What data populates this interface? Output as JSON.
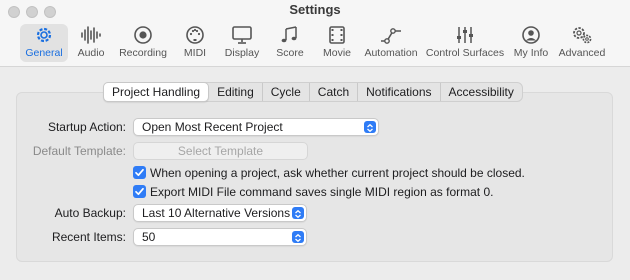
{
  "window": {
    "title": "Settings"
  },
  "toolbar": {
    "items": [
      {
        "label": "General",
        "icon": "gear-icon"
      },
      {
        "label": "Audio",
        "icon": "waveform-icon"
      },
      {
        "label": "Recording",
        "icon": "record-icon"
      },
      {
        "label": "MIDI",
        "icon": "midi-port-icon"
      },
      {
        "label": "Display",
        "icon": "monitor-icon"
      },
      {
        "label": "Score",
        "icon": "music-notes-icon"
      },
      {
        "label": "Movie",
        "icon": "film-icon"
      },
      {
        "label": "Automation",
        "icon": "automation-curve-icon"
      },
      {
        "label": "Control Surfaces",
        "icon": "faders-icon"
      },
      {
        "label": "My Info",
        "icon": "person-icon"
      },
      {
        "label": "Advanced",
        "icon": "gears-icon"
      }
    ],
    "selected": "General"
  },
  "tabs": {
    "items": [
      "Project Handling",
      "Editing",
      "Cycle",
      "Catch",
      "Notifications",
      "Accessibility"
    ],
    "selected": "Project Handling"
  },
  "form": {
    "startup_action": {
      "label": "Startup Action:",
      "value": "Open Most Recent Project"
    },
    "default_template": {
      "label": "Default Template:",
      "button": "Select Template"
    },
    "ask_close": {
      "label": "When opening a project, ask whether current project should be closed.",
      "checked": true
    },
    "export_midi": {
      "label": "Export MIDI File command saves single MIDI region as format 0.",
      "checked": true
    },
    "auto_backup": {
      "label": "Auto Backup:",
      "value": "Last 10 Alternative Versions"
    },
    "recent_items": {
      "label": "Recent Items:",
      "value": "50"
    }
  },
  "colors": {
    "accent": "#2f7cf6",
    "active_label": "#1a6fe0"
  }
}
